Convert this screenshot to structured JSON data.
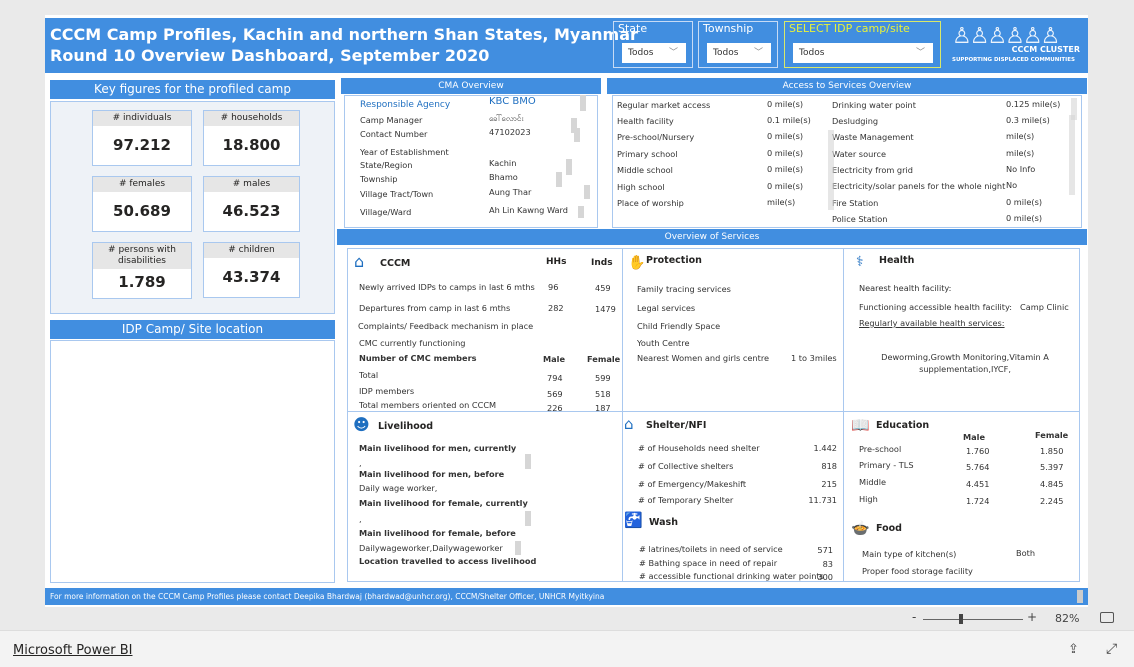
{
  "header": {
    "title_line1": "CCCM Camp Profiles, Kachin and northern Shan States, Myanmar",
    "title_line2": "Round 10 Overview Dashboard, September 2020",
    "slicers": [
      {
        "label": "State",
        "value": "Todos"
      },
      {
        "label": "Township",
        "value": "Todos"
      },
      {
        "label": "SELECT IDP camp/site",
        "value": "Todos"
      }
    ],
    "logo": {
      "line1": "CCCM CLUSTER",
      "line2": "SUPPORTING DISPLACED COMMUNITIES"
    }
  },
  "key_figures": {
    "title": "Key figures for the profiled camp",
    "cards": [
      {
        "label": "# individuals",
        "value": "97.212"
      },
      {
        "label": "# households",
        "value": "18.800"
      },
      {
        "label": "# females",
        "value": "50.689"
      },
      {
        "label": "# males",
        "value": "46.523"
      },
      {
        "label": "# persons with disabilities",
        "value": "1.789"
      },
      {
        "label": "# children",
        "value": "43.374"
      }
    ]
  },
  "location": {
    "title": "IDP Camp/ Site location"
  },
  "cma": {
    "title": "CMA Overview",
    "rows": [
      {
        "label": "Responsible Agency",
        "value": "KBC BMO"
      },
      {
        "label": "Camp Manager",
        "value": "ခေါ်လောင်း"
      },
      {
        "label": "Contact Number",
        "value": "47102023"
      },
      {
        "label": "Year of Establishment",
        "value": ""
      },
      {
        "label": "State/Region",
        "value": "Kachin"
      },
      {
        "label": "Township",
        "value": "Bhamo"
      },
      {
        "label": "Village Tract/Town",
        "value": "Aung Thar"
      },
      {
        "label": "Village/Ward",
        "value": "Ah Lin Kawng Ward"
      }
    ]
  },
  "access": {
    "title": "Access to Services Overview",
    "left": [
      {
        "label": "Regular market access",
        "value": "0 mile(s)"
      },
      {
        "label": "Health facility",
        "value": "0.1 mile(s)"
      },
      {
        "label": "Pre-school/Nursery",
        "value": "0 mile(s)"
      },
      {
        "label": "Primary school",
        "value": "0 mile(s)"
      },
      {
        "label": "Middle school",
        "value": "0 mile(s)"
      },
      {
        "label": "High school",
        "value": "0 mile(s)"
      },
      {
        "label": "Place of worship",
        "value": "mile(s)"
      }
    ],
    "right": [
      {
        "label": "Drinking water point",
        "value": "0.125 mile(s)"
      },
      {
        "label": "Desludging",
        "value": "0.3 mile(s)"
      },
      {
        "label": "Waste Management",
        "value": "mile(s)"
      },
      {
        "label": "Water source",
        "value": "mile(s)"
      },
      {
        "label": "Electricity from grid",
        "value": "No Info"
      },
      {
        "label": "Electricity/solar panels for the whole night",
        "value": "No"
      },
      {
        "label": "Fire Station",
        "value": "0 mile(s)"
      },
      {
        "label": "Police Station",
        "value": "0 mile(s)"
      }
    ]
  },
  "services": {
    "title": "Overview of Services",
    "cccm": {
      "title": "CCCM",
      "col1": "HHs",
      "col2": "Inds",
      "rows": [
        {
          "label": "Newly arrived IDPs to camps in last 6 mths",
          "hhs": "96",
          "inds": "459"
        },
        {
          "label": "Departures from camp in last 6 mths",
          "hhs": "282",
          "inds": "1479"
        }
      ],
      "complaints": "Complaints/ Feedback mechanism in place",
      "cmc": "CMC currently functioning",
      "members_title": "Number of CMC members",
      "male": "Male",
      "female": "Female",
      "members": [
        {
          "label": "Total",
          "male": "794",
          "female": "599"
        },
        {
          "label": "IDP members",
          "male": "569",
          "female": "518"
        },
        {
          "label": "Total members oriented on CCCM",
          "male": "226",
          "female": "187"
        }
      ]
    },
    "protection": {
      "title": "Protection",
      "items": [
        "Family tracing services",
        "Legal services",
        "Child Friendly Space",
        "Youth Centre"
      ],
      "women_label": "Nearest Women and girls centre",
      "women_value": "1 to 3miles"
    },
    "health": {
      "title": "Health",
      "nearest": "Nearest health facility:",
      "functioning_label": "Functioning accessible health facility:",
      "functioning_value": "Camp Clinic",
      "regular_label": "Regularly available health services:",
      "regular_value": "Deworming,Growth Monitoring,Vitamin A supplementation,IYCF,"
    },
    "livelihood": {
      "title": "Livelihood",
      "men_now": "Main livelihood for men, currently",
      "men_now_v": ",",
      "men_before": "Main livelihood for men, before",
      "men_before_v": "Daily wage worker,",
      "fem_now": "Main livelihood for female, currently",
      "fem_now_v": ",",
      "fem_before": "Main livelihood for female, before",
      "fem_before_v": "Dailywageworker,Dailywageworker",
      "location": "Location travelled to access livelihood"
    },
    "shelter": {
      "title": "Shelter/NFI",
      "rows": [
        {
          "label": "# of Households need shelter",
          "value": "1.442"
        },
        {
          "label": "# of Collective shelters",
          "value": "818"
        },
        {
          "label": "# of Emergency/Makeshift",
          "value": "215"
        },
        {
          "label": "# of Temporary Shelter",
          "value": "11.731"
        }
      ]
    },
    "wash": {
      "title": "Wash",
      "rows": [
        {
          "label": "# latrines/toilets in need of service",
          "value": "571"
        },
        {
          "label": "# Bathing space in need of repair",
          "value": "83"
        },
        {
          "label": "# accessible functional drinking water points",
          "value": "300"
        }
      ]
    },
    "education": {
      "title": "Education",
      "male": "Male",
      "female": "Female",
      "rows": [
        {
          "label": "Pre-school",
          "male": "1.760",
          "female": "1.850"
        },
        {
          "label": "Primary - TLS",
          "male": "5.764",
          "female": "5.397"
        },
        {
          "label": "Middle",
          "male": "4.451",
          "female": "4.845"
        },
        {
          "label": "High",
          "male": "1.724",
          "female": "2.245"
        }
      ]
    },
    "food": {
      "title": "Food",
      "rows": [
        {
          "label": "Main type of kitchen(s)",
          "value": "Both"
        },
        {
          "label": "Proper food storage facility",
          "value": ""
        }
      ]
    }
  },
  "footer": {
    "text": "For more information on the CCCM Camp Profiles please contact Deepika Bhardwaj (bhardwad@unhcr.org), CCCM/Shelter Officer, UNHCR Myitkyina"
  },
  "zoom": {
    "minus": "-",
    "plus": "+",
    "level": "82%",
    "percent": 82
  },
  "brand": {
    "link": "Microsoft Power BI"
  },
  "colors": {
    "accent": "#418ee0",
    "slicer_highlight": "#e8f23a"
  }
}
